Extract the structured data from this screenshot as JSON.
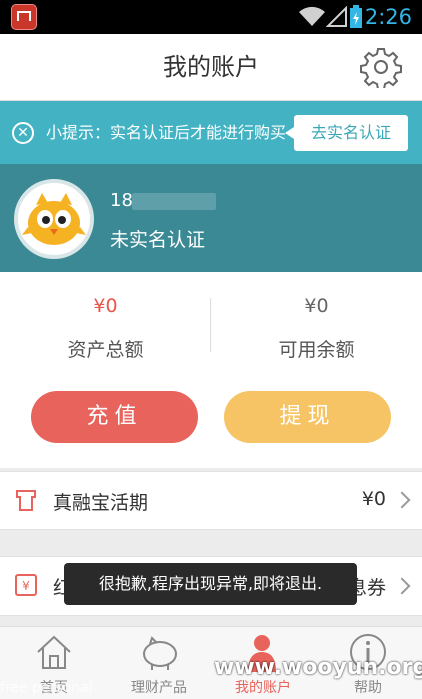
{
  "status_bar": {
    "time": "2:26"
  },
  "header": {
    "title": "我的账户"
  },
  "notice": {
    "text": "小提示：实名认证后才能进行购买",
    "button": "去实名认证"
  },
  "profile": {
    "phone_prefix": "18",
    "status": "未实名认证"
  },
  "assets": {
    "total_amount": "¥0",
    "total_label": "资产总额",
    "available_amount": "¥0",
    "available_label": "可用余额"
  },
  "actions": {
    "recharge": "充值",
    "withdraw": "提现"
  },
  "list": [
    {
      "label": "真融宝活期",
      "value": "¥0"
    },
    {
      "label": "红",
      "value": "息券"
    }
  ],
  "toast": {
    "text": "很抱歉,程序出现异常,即将退出."
  },
  "bottom_nav": {
    "items": [
      {
        "label": "首页"
      },
      {
        "label": "理财产品"
      },
      {
        "label": "我的账户"
      },
      {
        "label": "帮助"
      }
    ]
  },
  "watermark": {
    "text": "www.wooyun.org",
    "text2": "free personal"
  },
  "colors": {
    "accent": "#43b3c4",
    "profile_bg": "#3b8994",
    "red": "#e8635b",
    "yellow": "#f6c464"
  }
}
